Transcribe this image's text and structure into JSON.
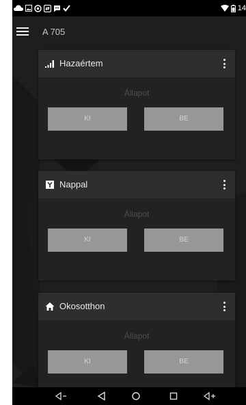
{
  "statusbar": {
    "clock_fragment": "14",
    "icons_left": [
      "cloud-icon",
      "image-icon",
      "circle-dot-icon",
      "sync-icon",
      "chat-icon",
      "check-icon"
    ],
    "icons_right": [
      "wifi-icon",
      "battery-icon"
    ]
  },
  "app": {
    "title": "A 705",
    "menu_icon": "hamburger-menu-icon"
  },
  "cards": [
    {
      "title": "Hazaértem",
      "icon": "signal-bars-icon",
      "status": "Állapot",
      "off_label": "KI",
      "on_label": "BE"
    },
    {
      "title": "Nappal",
      "icon": "y-box-icon",
      "status": "Állapot",
      "off_label": "KI",
      "on_label": "BE"
    },
    {
      "title": "Okosotthon",
      "icon": "home-icon",
      "status": "Állapot",
      "off_label": "KI",
      "on_label": "BE"
    }
  ],
  "navbar": {
    "buttons": [
      "volume-down-icon",
      "back-icon",
      "home-circle-icon",
      "recents-icon",
      "volume-up-icon"
    ]
  },
  "colors": {
    "background": "#1e1e1e",
    "card": "#222222",
    "card_header": "#2e2e2e",
    "button": "#979797",
    "status_text": "#4e4e4e"
  }
}
